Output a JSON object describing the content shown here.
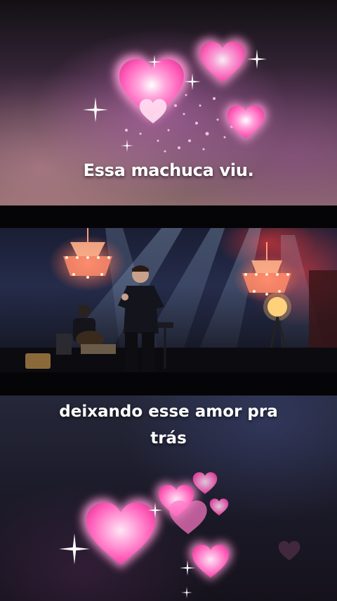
{
  "captions": {
    "top": "Essa machuca viu.",
    "bottom": "deixando esse amor pra trás"
  },
  "colors": {
    "heart_pink": "#ff7ac8",
    "heart_glow": "#ffc2e8",
    "sparkle": "#ffffff",
    "chandelier": "#ff8a6a",
    "stage_light": "#9ec8ff"
  },
  "icons": [
    "heart-icon",
    "sparkle-icon",
    "chandelier",
    "spotlight"
  ]
}
